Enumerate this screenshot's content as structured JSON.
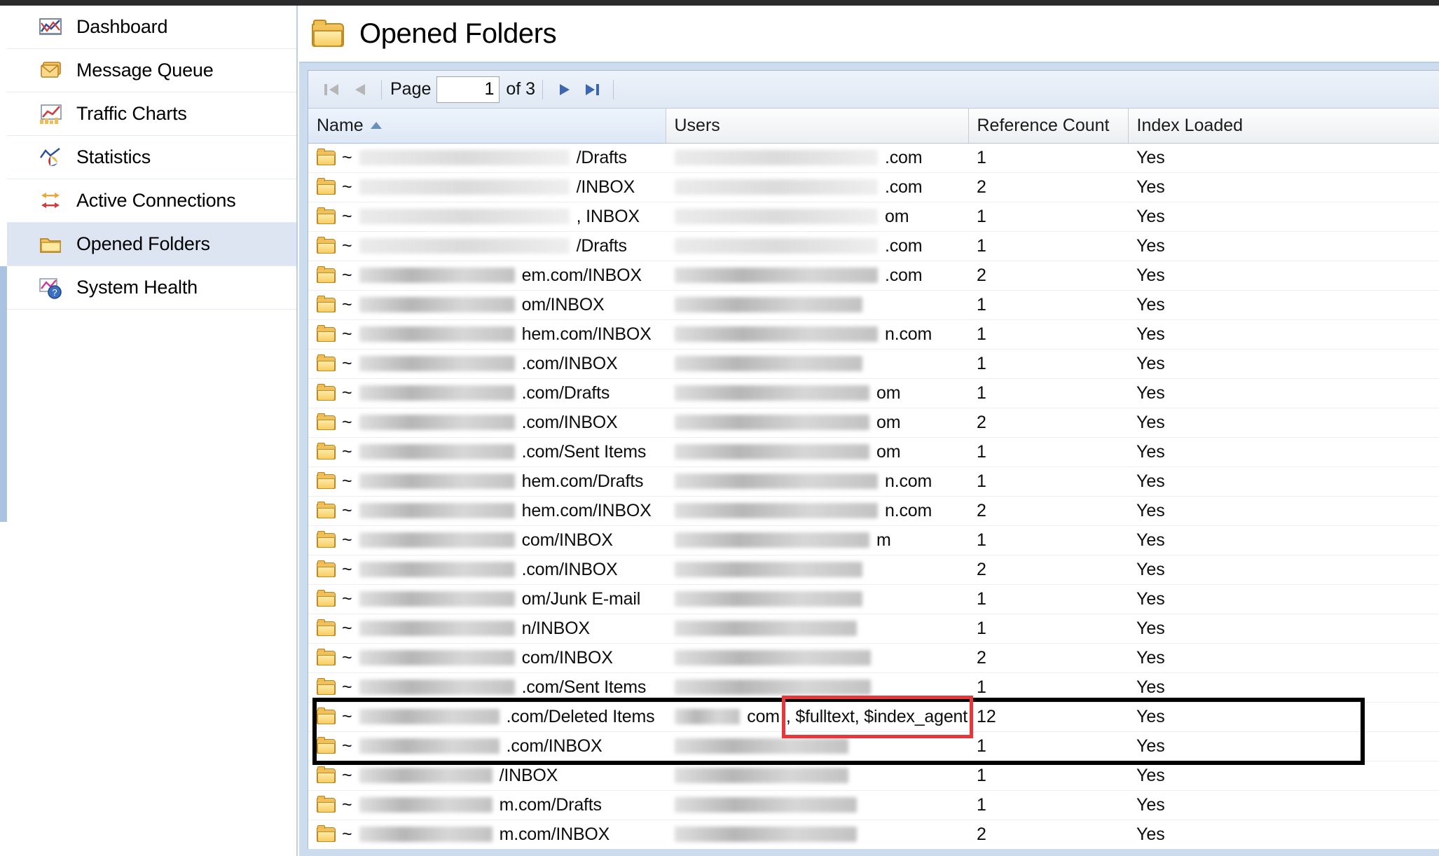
{
  "app": {
    "accent_blue": "#a9c3e0",
    "selected_row_bg": "#dde5f3",
    "highlight_red": "#e8373a",
    "emphasis_black": "#000000"
  },
  "sidebar": {
    "items": [
      {
        "label": "Dashboard",
        "icon": "line-chart-icon",
        "selected": false
      },
      {
        "label": "Message Queue",
        "icon": "envelope-stack-icon",
        "selected": false
      },
      {
        "label": "Traffic Charts",
        "icon": "traffic-chart-icon",
        "selected": false
      },
      {
        "label": "Statistics",
        "icon": "pie-chart-icon",
        "selected": false
      },
      {
        "label": "Active Connections",
        "icon": "connections-icon",
        "selected": false
      },
      {
        "label": "Opened Folders",
        "icon": "folder-icon",
        "selected": true
      },
      {
        "label": "System Health",
        "icon": "health-question-icon",
        "selected": false
      }
    ]
  },
  "header": {
    "title": "Opened Folders",
    "icon": "folder-icon"
  },
  "pager": {
    "first_icon": "first-page-icon",
    "prev_icon": "prev-page-icon",
    "next_icon": "next-page-icon",
    "last_icon": "last-page-icon",
    "page_label": "Page",
    "page_value": "1",
    "of_label": "of 3",
    "total_pages": "3",
    "first_enabled": false,
    "prev_enabled": false,
    "next_enabled": true,
    "last_enabled": true
  },
  "table": {
    "columns": [
      {
        "label": "Name",
        "sorted": true,
        "sort_dir": "asc"
      },
      {
        "label": "Users",
        "sorted": false,
        "sort_dir": ""
      },
      {
        "label": "Reference Count",
        "sorted": false,
        "sort_dir": ""
      },
      {
        "label": "Index Loaded",
        "sorted": false,
        "sort_dir": ""
      }
    ],
    "rows": [
      {
        "name_prefix": "~",
        "name_redacted_w": 300,
        "name_tail": "/Drafts",
        "users_redacted_w": 290,
        "users_tail": ".com",
        "ref_count": "1",
        "index_loaded": "Yes",
        "redact_light": true
      },
      {
        "name_prefix": "~",
        "name_redacted_w": 300,
        "name_tail": "/INBOX",
        "users_redacted_w": 290,
        "users_tail": ".com",
        "ref_count": "2",
        "index_loaded": "Yes",
        "redact_light": true
      },
      {
        "name_prefix": "~",
        "name_redacted_w": 300,
        "name_tail": ", INBOX",
        "users_redacted_w": 290,
        "users_tail": "om",
        "ref_count": "1",
        "index_loaded": "Yes",
        "redact_light": true
      },
      {
        "name_prefix": "~",
        "name_redacted_w": 300,
        "name_tail": "/Drafts",
        "users_redacted_w": 290,
        "users_tail": ".com",
        "ref_count": "1",
        "index_loaded": "Yes",
        "redact_light": true
      },
      {
        "name_prefix": "~",
        "name_redacted_w": 222,
        "name_tail": "em.com/INBOX",
        "users_redacted_w": 290,
        "users_tail": ".com",
        "ref_count": "2",
        "index_loaded": "Yes",
        "redact_light": false
      },
      {
        "name_prefix": "~",
        "name_redacted_w": 222,
        "name_tail": "om/INBOX",
        "users_redacted_w": 268,
        "users_tail": "",
        "ref_count": "1",
        "index_loaded": "Yes",
        "redact_light": false
      },
      {
        "name_prefix": "~",
        "name_redacted_w": 222,
        "name_tail": "hem.com/INBOX",
        "users_redacted_w": 290,
        "users_tail": "n.com",
        "ref_count": "1",
        "index_loaded": "Yes",
        "redact_light": false
      },
      {
        "name_prefix": "~",
        "name_redacted_w": 222,
        "name_tail": ".com/INBOX",
        "users_redacted_w": 268,
        "users_tail": "",
        "ref_count": "1",
        "index_loaded": "Yes",
        "redact_light": false
      },
      {
        "name_prefix": "~",
        "name_redacted_w": 222,
        "name_tail": ".com/Drafts",
        "users_redacted_w": 278,
        "users_tail": "om",
        "ref_count": "1",
        "index_loaded": "Yes",
        "redact_light": false
      },
      {
        "name_prefix": "~",
        "name_redacted_w": 222,
        "name_tail": ".com/INBOX",
        "users_redacted_w": 278,
        "users_tail": "om",
        "ref_count": "2",
        "index_loaded": "Yes",
        "redact_light": false
      },
      {
        "name_prefix": "~",
        "name_redacted_w": 222,
        "name_tail": ".com/Sent Items",
        "users_redacted_w": 278,
        "users_tail": "om",
        "ref_count": "1",
        "index_loaded": "Yes",
        "redact_light": false
      },
      {
        "name_prefix": "~",
        "name_redacted_w": 222,
        "name_tail": "hem.com/Drafts",
        "users_redacted_w": 290,
        "users_tail": "n.com",
        "ref_count": "1",
        "index_loaded": "Yes",
        "redact_light": false
      },
      {
        "name_prefix": "~",
        "name_redacted_w": 222,
        "name_tail": "hem.com/INBOX",
        "users_redacted_w": 290,
        "users_tail": "n.com",
        "ref_count": "2",
        "index_loaded": "Yes",
        "redact_light": false
      },
      {
        "name_prefix": "~",
        "name_redacted_w": 222,
        "name_tail": "com/INBOX",
        "users_redacted_w": 278,
        "users_tail": "m",
        "ref_count": "1",
        "index_loaded": "Yes",
        "redact_light": false
      },
      {
        "name_prefix": "~",
        "name_redacted_w": 222,
        "name_tail": ".com/INBOX",
        "users_redacted_w": 268,
        "users_tail": "",
        "ref_count": "2",
        "index_loaded": "Yes",
        "redact_light": false
      },
      {
        "name_prefix": "~",
        "name_redacted_w": 222,
        "name_tail": "om/Junk E-mail",
        "users_redacted_w": 268,
        "users_tail": "",
        "ref_count": "1",
        "index_loaded": "Yes",
        "redact_light": false
      },
      {
        "name_prefix": "~",
        "name_redacted_w": 222,
        "name_tail": "n/INBOX",
        "users_redacted_w": 260,
        "users_tail": "",
        "ref_count": "1",
        "index_loaded": "Yes",
        "redact_light": false
      },
      {
        "name_prefix": "~",
        "name_redacted_w": 222,
        "name_tail": "com/INBOX",
        "users_redacted_w": 280,
        "users_tail": "",
        "ref_count": "2",
        "index_loaded": "Yes",
        "redact_light": false
      },
      {
        "name_prefix": "~",
        "name_redacted_w": 222,
        "name_tail": ".com/Sent Items",
        "users_redacted_w": 280,
        "users_tail": "",
        "ref_count": "1",
        "index_loaded": "Yes",
        "redact_light": false
      },
      {
        "name_prefix": "~",
        "name_redacted_w": 200,
        "name_tail": ".com/Deleted Items",
        "users_redacted_w": 248,
        "users_tail": "com",
        "ref_count": "12",
        "index_loaded": "Yes",
        "redact_light": false,
        "flag": ", $fulltext, $index_agent"
      },
      {
        "name_prefix": "~",
        "name_redacted_w": 200,
        "name_tail": ".com/INBOX",
        "users_redacted_w": 248,
        "users_tail": "",
        "ref_count": "1",
        "index_loaded": "Yes",
        "redact_light": false
      },
      {
        "name_prefix": "~",
        "name_redacted_w": 190,
        "name_tail": "/INBOX",
        "users_redacted_w": 248,
        "users_tail": "",
        "ref_count": "1",
        "index_loaded": "Yes",
        "redact_light": false
      },
      {
        "name_prefix": "~",
        "name_redacted_w": 190,
        "name_tail": "m.com/Drafts",
        "users_redacted_w": 260,
        "users_tail": "",
        "ref_count": "1",
        "index_loaded": "Yes",
        "redact_light": false
      },
      {
        "name_prefix": "~",
        "name_redacted_w": 190,
        "name_tail": "m.com/INBOX",
        "users_redacted_w": 260,
        "users_tail": "",
        "ref_count": "2",
        "index_loaded": "Yes",
        "redact_light": false
      }
    ]
  },
  "annotations": {
    "emphasis_box_label": "highlighted-rows-box",
    "red_box_label": "fulltext-index-agent-highlight",
    "red_box_text": "$fulltext, $index_agent"
  }
}
